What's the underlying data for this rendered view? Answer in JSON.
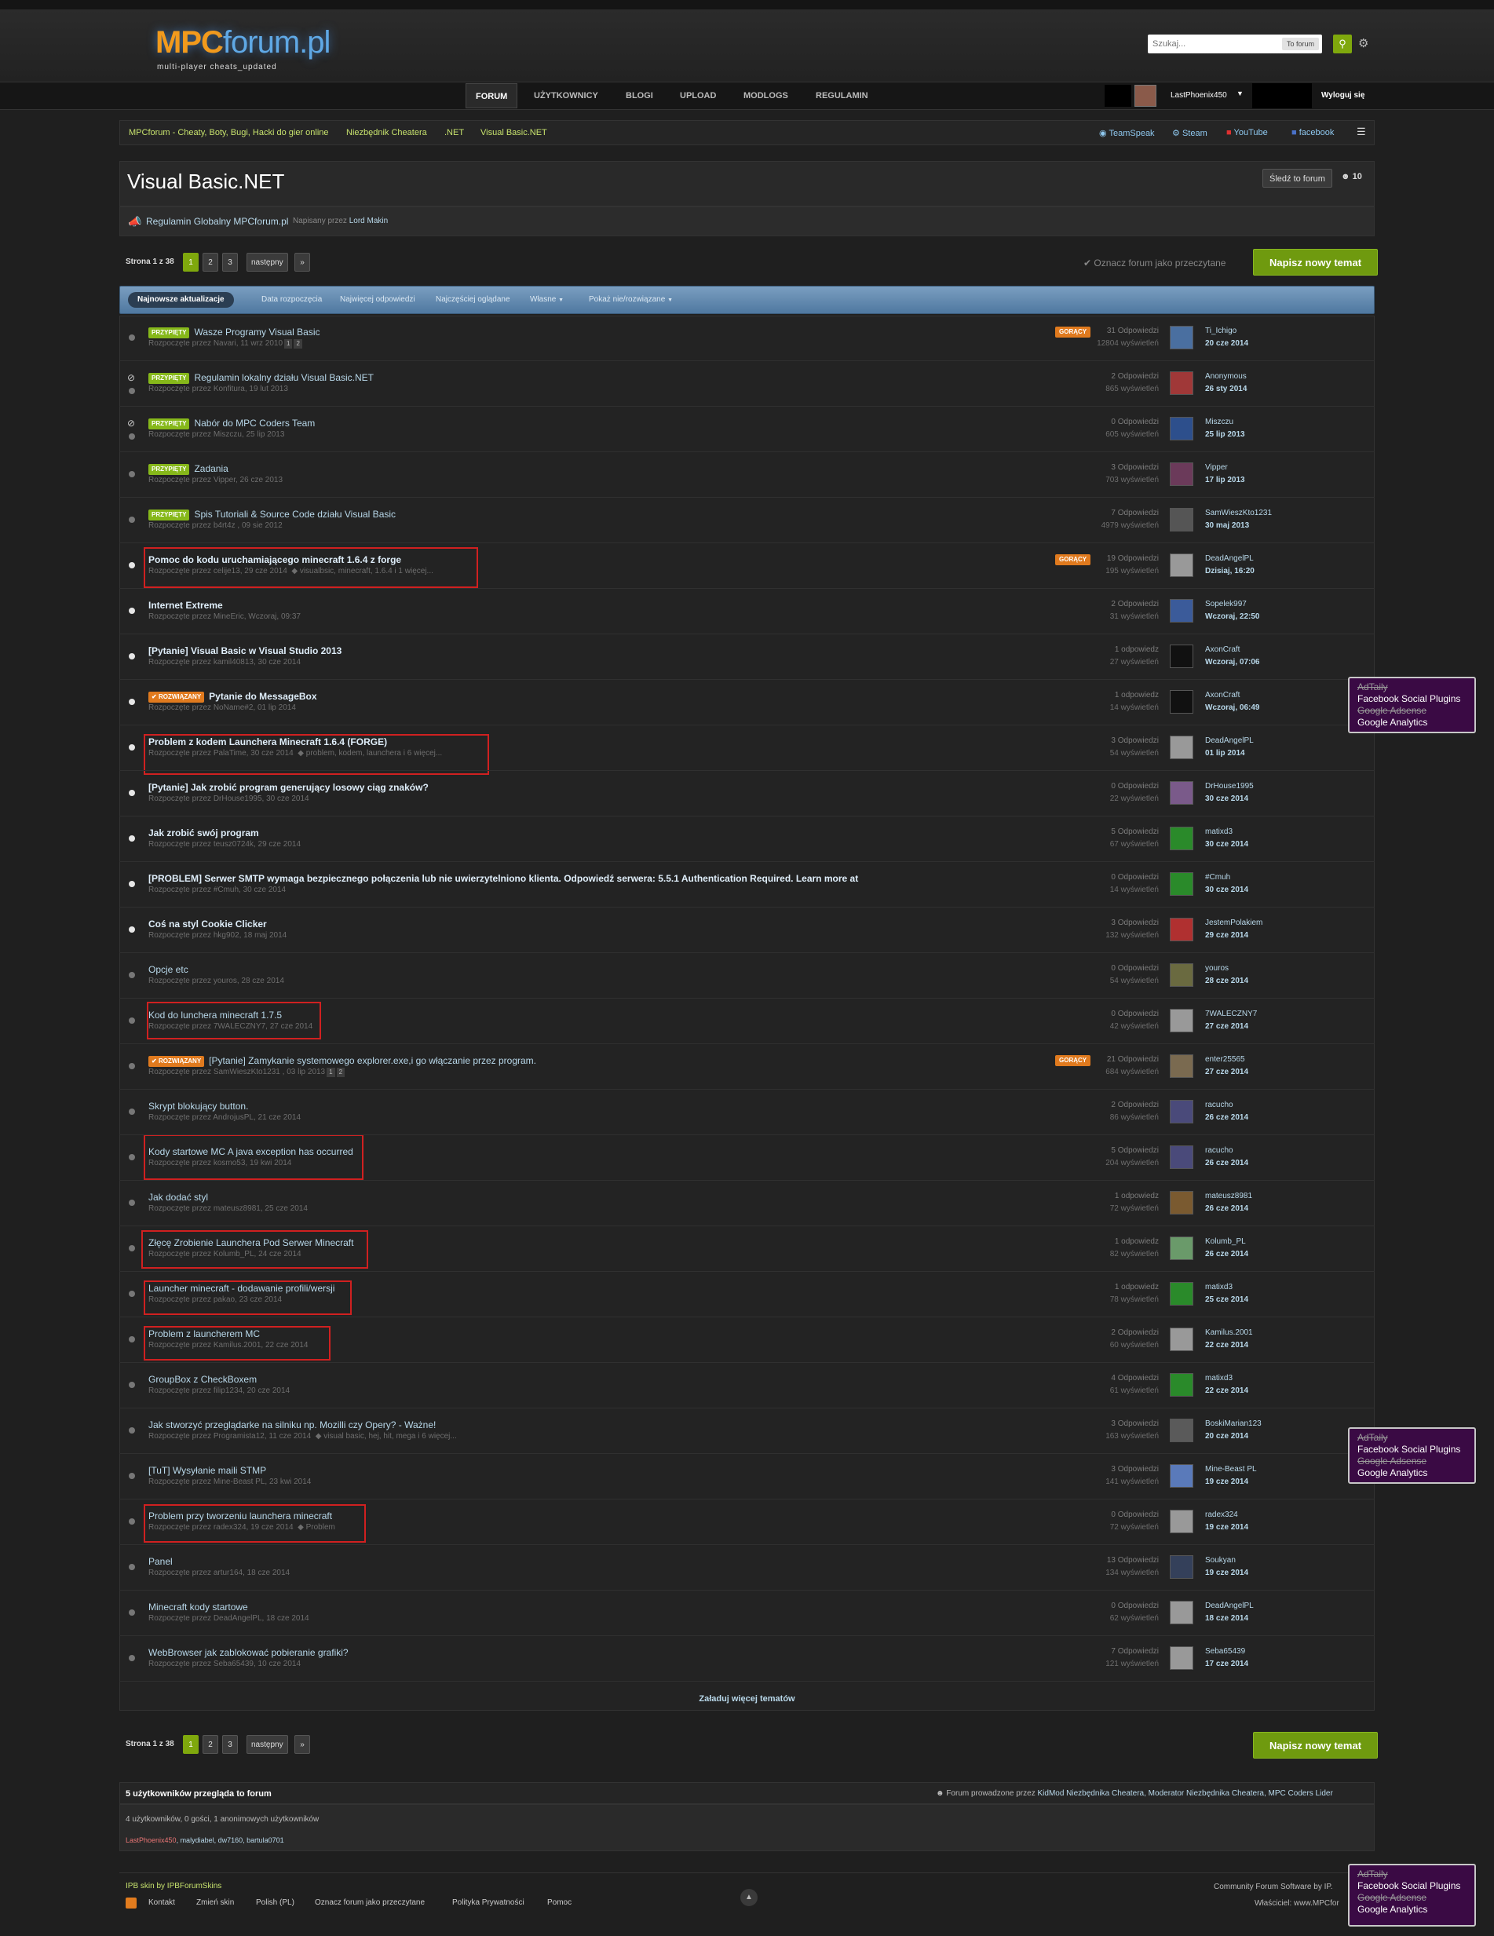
{
  "header": {
    "logo_main": "MPC",
    "logo_suffix": "forum.pl",
    "logo_sub": "multi-player cheats_updated",
    "search_placeholder": "Szukaj...",
    "search_scope": "To forum",
    "search_icon": "search-icon",
    "settings_icon": "gear-icon"
  },
  "nav": {
    "tabs": [
      "FORUM",
      "UŻYTKOWNICY",
      "BLOGI",
      "UPLOAD",
      "MODLOGS",
      "REGULAMIN"
    ],
    "active": "FORUM"
  },
  "user": {
    "name": "LastPhoenix450",
    "logout": "Wyloguj się"
  },
  "breadcrumb": {
    "items": [
      "MPCforum - Cheaty, Boty, Bugi, Hacki do gier online",
      "Niezbędnik Cheatera",
      ".NET",
      "Visual Basic.NET"
    ]
  },
  "social": {
    "links": [
      "TeamSpeak",
      "Steam",
      "YouTube",
      "facebook"
    ]
  },
  "forum": {
    "title": "Visual Basic.NET",
    "follow_label": "Śledź to forum",
    "followers": "10",
    "announcement_title": "Regulamin Globalny MPCforum.pl",
    "announcement_by_label": "Napisany przez",
    "announcement_author": "Lord Makin",
    "mark_read": "Oznacz forum jako przeczytane",
    "new_topic": "Napisz nowy temat",
    "load_more": "Załaduj więcej tematów"
  },
  "pagination": {
    "label": "Strona 1 z 38",
    "pages": [
      "1",
      "2",
      "3"
    ],
    "next": "następny",
    "last": "»"
  },
  "sort": {
    "items": [
      "Najnowsze aktualizacje",
      "Data rozpoczęcia",
      "Najwięcej odpowiedzi",
      "Najczęściej oglądane",
      "Własne",
      "Pokaż nie/rozwiązane"
    ],
    "active": "Najnowsze aktualizacje"
  },
  "badges": {
    "pinned": "PRZYPIĘTY",
    "solved": "ROZWIĄZANY",
    "hot": "GORĄCY"
  },
  "topics": [
    {
      "title": "Wasze Programy Visual Basic",
      "meta": "Rozpoczęte przez Navari, 11 wrz 2010",
      "pages": [
        "1",
        "2"
      ],
      "pinned": true,
      "hot": true,
      "replies": "31 Odpowiedzi",
      "views": "12804 wyświetleń",
      "poster": "Ti_Ichigo",
      "date": "20 cze 2014"
    },
    {
      "title": "Regulamin lokalny działu Visual Basic.NET",
      "meta": "Rozpoczęte przez Konfitura, 19 lut 2013",
      "pinned": true,
      "locked": true,
      "replies": "2 Odpowiedzi",
      "views": "865 wyświetleń",
      "poster": "Anonymous",
      "date": "26 sty 2014"
    },
    {
      "title": "Nabór do MPC Coders Team",
      "meta": "Rozpoczęte przez Miszczu, 25 lip 2013",
      "pinned": true,
      "locked": true,
      "replies": "0 Odpowiedzi",
      "views": "605 wyświetleń",
      "poster": "Miszczu",
      "date": "25 lip 2013"
    },
    {
      "title": "Zadania",
      "meta": "Rozpoczęte przez Vipper, 26 cze 2013",
      "pinned": true,
      "replies": "3 Odpowiedzi",
      "views": "703 wyświetleń",
      "poster": "Vipper",
      "date": "17 lip 2013"
    },
    {
      "title": "Spis Tutoriali & Source Code działu Visual Basic",
      "meta": "Rozpoczęte przez b4rt4z , 09 sie 2012",
      "pinned": true,
      "replies": "7 Odpowiedzi",
      "views": "4979 wyświetleń",
      "poster": "SamWieszKto1231",
      "date": "30 maj 2013"
    },
    {
      "title": "Pomoc do kodu uruchamiającego minecraft 1.6.4 z forge",
      "meta": "Rozpoczęte przez celije13, 29 cze 2014",
      "tags": "visualbsic, minecraft, 1.6.4 i 1 więcej...",
      "unread": true,
      "hot": true,
      "replies": "19 Odpowiedzi",
      "views": "195 wyświetleń",
      "poster": "DeadAngelPL",
      "date": "Dzisiaj, 16:20"
    },
    {
      "title": "Internet Extreme",
      "meta": "Rozpoczęte przez MineEric, Wczoraj, 09:37",
      "unread": true,
      "replies": "2 Odpowiedzi",
      "views": "31 wyświetleń",
      "poster": "Sopelek997",
      "date": "Wczoraj, 22:50"
    },
    {
      "title": "[Pytanie] Visual Basic w Visual Studio 2013",
      "meta": "Rozpoczęte przez kamil40813, 30 cze 2014",
      "unread": true,
      "replies": "1 odpowiedz",
      "views": "27 wyświetleń",
      "poster": "AxonCraft",
      "date": "Wczoraj, 07:06"
    },
    {
      "title": "Pytanie do MessageBox",
      "meta": "Rozpoczęte przez NoName#2, 01 lip 2014",
      "unread": true,
      "solved": true,
      "replies": "1 odpowiedz",
      "views": "14 wyświetleń",
      "poster": "AxonCraft",
      "date": "Wczoraj, 06:49"
    },
    {
      "title": "Problem z kodem Launchera Minecraft 1.6.4 (FORGE)",
      "meta": "Rozpoczęte przez PalaTime, 30 cze 2014",
      "tags": "problem, kodem, launchera i 6 więcej...",
      "unread": true,
      "replies": "3 Odpowiedzi",
      "views": "54 wyświetleń",
      "poster": "DeadAngelPL",
      "date": "01 lip 2014"
    },
    {
      "title": "[Pytanie] Jak zrobić program generujący losowy ciąg znaków?",
      "meta": "Rozpoczęte przez DrHouse1995, 30 cze 2014",
      "unread": true,
      "replies": "0 Odpowiedzi",
      "views": "22 wyświetleń",
      "poster": "DrHouse1995",
      "date": "30 cze 2014"
    },
    {
      "title": "Jak zrobić swój program",
      "meta": "Rozpoczęte przez teusz0724k, 29 cze 2014",
      "unread": true,
      "replies": "5 Odpowiedzi",
      "views": "67 wyświetleń",
      "poster": "matixd3",
      "date": "30 cze 2014"
    },
    {
      "title": "[PROBLEM] Serwer SMTP wymaga bezpiecznego połączenia lub nie uwierzytelniono klienta. Odpowiedź serwera: 5.5.1 Authentication Required. Learn more at",
      "meta": "Rozpoczęte przez #Cmuh, 30 cze 2014",
      "unread": true,
      "replies": "0 Odpowiedzi",
      "views": "14 wyświetleń",
      "poster": "#Cmuh",
      "date": "30 cze 2014"
    },
    {
      "title": "Coś na styl Cookie Clicker",
      "meta": "Rozpoczęte przez hkg902, 18 maj 2014",
      "unread": true,
      "replies": "3 Odpowiedzi",
      "views": "132 wyświetleń",
      "poster": "JestemPolakiem",
      "date": "29 cze 2014"
    },
    {
      "title": "Opcje etc",
      "meta": "Rozpoczęte przez youros, 28 cze 2014",
      "replies": "0 Odpowiedzi",
      "views": "54 wyświetleń",
      "poster": "youros",
      "date": "28 cze 2014"
    },
    {
      "title": "Kod do lunchera minecraft 1.7.5",
      "meta": "Rozpoczęte przez 7WALECZNY7, 27 cze 2014",
      "replies": "0 Odpowiedzi",
      "views": "42 wyświetleń",
      "poster": "7WALECZNY7",
      "date": "27 cze 2014"
    },
    {
      "title": "[Pytanie] Zamykanie systemowego explorer.exe,i go włączanie przez program.",
      "meta": "Rozpoczęte przez SamWieszKto1231 , 03 lip 2013",
      "pages": [
        "1",
        "2"
      ],
      "solved": true,
      "hot": true,
      "replies": "21 Odpowiedzi",
      "views": "684 wyświetleń",
      "poster": "enter25565",
      "date": "27 cze 2014"
    },
    {
      "title": "Skrypt blokujący button.",
      "meta": "Rozpoczęte przez AndrojusPL, 21 cze 2014",
      "replies": "2 Odpowiedzi",
      "views": "86 wyświetleń",
      "poster": "racucho",
      "date": "26 cze 2014"
    },
    {
      "title": "Kody startowe MC A java exception has occurred",
      "meta": "Rozpoczęte przez kosmo53, 19 kwi 2014",
      "replies": "5 Odpowiedzi",
      "views": "204 wyświetleń",
      "poster": "racucho",
      "date": "26 cze 2014"
    },
    {
      "title": "Jak dodać styl",
      "meta": "Rozpoczęte przez mateusz8981, 25 cze 2014",
      "replies": "1 odpowiedz",
      "views": "72 wyświetleń",
      "poster": "mateusz8981",
      "date": "26 cze 2014"
    },
    {
      "title": "Złęcę Zrobienie Launchera Pod Serwer Minecraft",
      "meta": "Rozpoczęte przez Kolumb_PL, 24 cze 2014",
      "replies": "1 odpowiedz",
      "views": "82 wyświetleń",
      "poster": "Kolumb_PL",
      "date": "26 cze 2014"
    },
    {
      "title": "Launcher minecraft - dodawanie profili/wersji",
      "meta": "Rozpoczęte przez pakao, 23 cze 2014",
      "replies": "1 odpowiedz",
      "views": "78 wyświetleń",
      "poster": "matixd3",
      "date": "25 cze 2014"
    },
    {
      "title": "Problem z launcherem MC",
      "meta": "Rozpoczęte przez Kamilus.2001, 22 cze 2014",
      "replies": "2 Odpowiedzi",
      "views": "60 wyświetleń",
      "poster": "Kamilus.2001",
      "date": "22 cze 2014"
    },
    {
      "title": "GroupBox z CheckBoxem",
      "meta": "Rozpoczęte przez filip1234, 20 cze 2014",
      "replies": "4 Odpowiedzi",
      "views": "61 wyświetleń",
      "poster": "matixd3",
      "date": "22 cze 2014"
    },
    {
      "title": "Jak stworzyć przeglądarke na silniku np. Mozilli czy Opery? - Ważne!",
      "meta": "Rozpoczęte przez Programista12, 11 cze 2014",
      "tags": "visual basic, hej, hit, mega i 6 więcej...",
      "replies": "3 Odpowiedzi",
      "views": "163 wyświetleń",
      "poster": "BoskiMarian123",
      "date": "20 cze 2014"
    },
    {
      "title": "[TuT] Wysyłanie maili STMP",
      "meta": "Rozpoczęte przez Mine-Beast PL, 23 kwi 2014",
      "replies": "3 Odpowiedzi",
      "views": "141 wyświetleń",
      "poster": "Mine-Beast PL",
      "date": "19 cze 2014"
    },
    {
      "title": "Problem przy tworzeniu launchera minecraft",
      "meta": "Rozpoczęte przez radex324, 19 cze 2014",
      "tags": "Problem",
      "replies": "0 Odpowiedzi",
      "views": "72 wyświetleń",
      "poster": "radex324",
      "date": "19 cze 2014"
    },
    {
      "title": "Panel",
      "meta": "Rozpoczęte przez artur164, 18 cze 2014",
      "replies": "13 Odpowiedzi",
      "views": "134 wyświetleń",
      "poster": "Soukyan",
      "date": "19 cze 2014"
    },
    {
      "title": "Minecraft kody startowe",
      "meta": "Rozpoczęte przez DeadAngelPL, 18 cze 2014",
      "replies": "0 Odpowiedzi",
      "views": "62 wyświetleń",
      "poster": "DeadAngelPL",
      "date": "18 cze 2014"
    },
    {
      "title": "WebBrowser jak zablokować pobieranie grafiki?",
      "meta": "Rozpoczęte przez Seba65439, 10 cze 2014",
      "replies": "7 Odpowiedzi",
      "views": "121 wyświetleń",
      "poster": "Seba65439",
      "date": "17 cze 2014"
    }
  ],
  "who": {
    "title": "5 użytkowników przegląda to forum",
    "mods_prefix": "Forum prowadzone przez",
    "mods": "KidMod Niezbędnika Cheatera, Moderator Niezbędnika Cheatera, MPC Coders Lider",
    "counts": "4 użytkowników, 0 gości, 1 anonimowych użytkowników",
    "me": "LastPhoenix450",
    "users": ", malydiabel, dw7160, bartula0701"
  },
  "footer": {
    "skin": "IPB skin by IPBForumSkins",
    "links": [
      "Kontakt",
      "Zmień skin",
      "Polish (PL)",
      "Oznacz forum jako przeczytane",
      "Polityka Prywatności",
      "Pomoc"
    ],
    "copyright": "Community Forum Software by IP.",
    "owner": "Właściciel: www.MPCfor"
  },
  "overlay": {
    "items": [
      "AdTaily",
      "Facebook Social Plugins",
      "Google Adsense",
      "Google Analytics"
    ]
  }
}
